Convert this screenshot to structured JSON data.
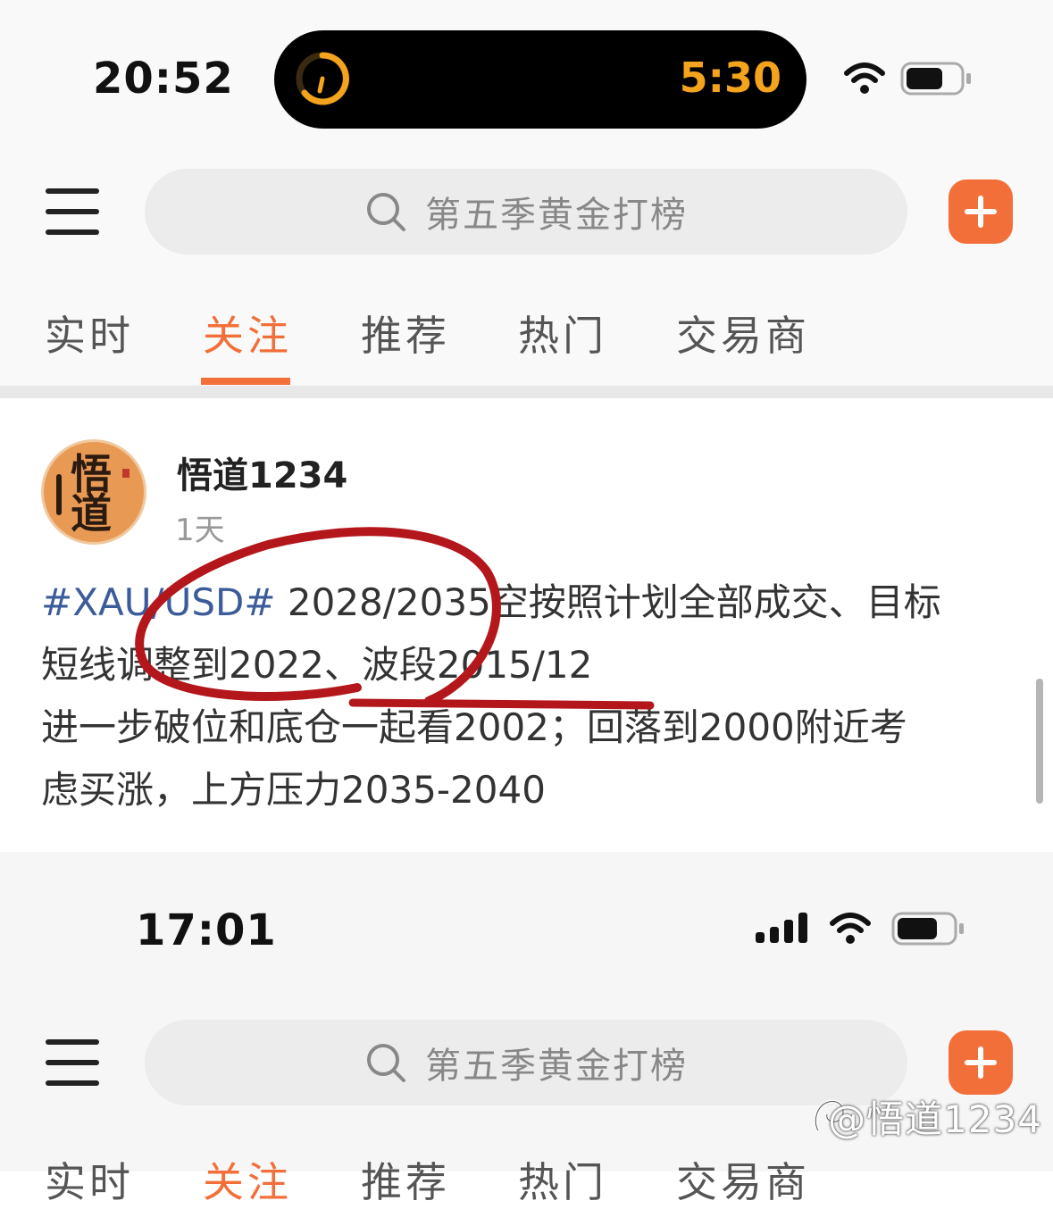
{
  "screen1": {
    "status_time": "20:52",
    "island_timer": "5:30",
    "search_placeholder": "第五季黄金打榜",
    "tabs": [
      {
        "label": "实时",
        "active": false
      },
      {
        "label": "关注",
        "active": true
      },
      {
        "label": "推荐",
        "active": false
      },
      {
        "label": "热门",
        "active": false
      },
      {
        "label": "交易商",
        "active": false
      }
    ],
    "post": {
      "username": "悟道1234",
      "time": "1天",
      "hashtag": "#XAU/USD#",
      "lines": [
        " 2028/2035空按照计划全部成交、目标",
        "短线调整到2022、波段2015/12",
        "进一步破位和底仓一起看2002；回落到2000附近考",
        "虑买涨，上方压力2035-2040"
      ]
    }
  },
  "screen2": {
    "status_time": "17:01",
    "search_placeholder": "第五季黄金打榜",
    "tabs": [
      {
        "label": "实时",
        "active": false
      },
      {
        "label": "关注",
        "active": true
      },
      {
        "label": "推荐",
        "active": false
      },
      {
        "label": "热门",
        "active": false
      },
      {
        "label": "交易商",
        "active": false
      }
    ]
  },
  "watermark": "@悟道1234",
  "colors": {
    "accent": "#f36f3a",
    "hashtag": "#3b5b9a",
    "island_timer": "#f4a31c",
    "annotation": "#b3171c"
  }
}
